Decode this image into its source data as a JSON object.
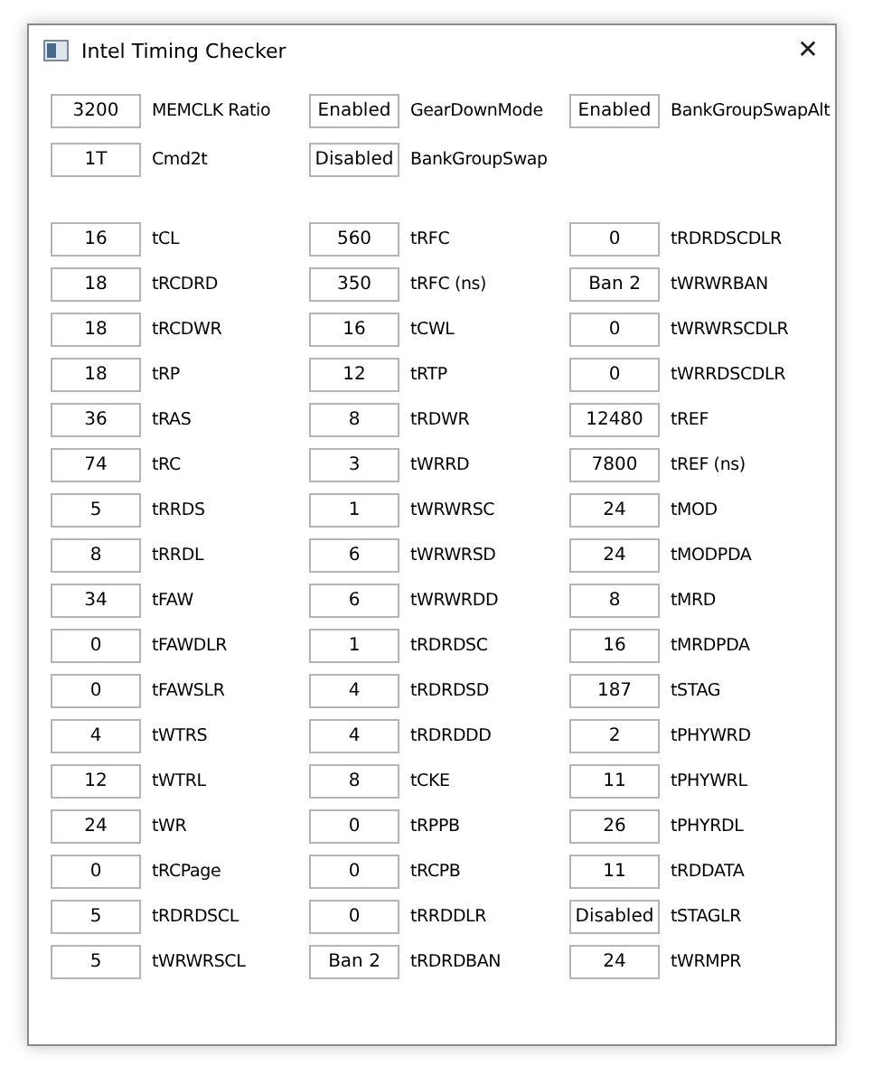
{
  "window": {
    "title": "Intel Timing Checker",
    "close": "✕"
  },
  "general": [
    {
      "value": "3200",
      "label": "MEMCLK Ratio"
    },
    {
      "value": "Enabled",
      "label": "GearDownMode"
    },
    {
      "value": "Enabled",
      "label": "BankGroupSwapAlt"
    },
    {
      "value": "1T",
      "label": "Cmd2t"
    },
    {
      "value": "Disabled",
      "label": "BankGroupSwap"
    }
  ],
  "timings": [
    {
      "value": "16",
      "label": "tCL"
    },
    {
      "value": "560",
      "label": "tRFC"
    },
    {
      "value": "0",
      "label": "tRDRDSCDLR"
    },
    {
      "value": "18",
      "label": "tRCDRD"
    },
    {
      "value": "350",
      "label": "tRFC (ns)"
    },
    {
      "value": "Ban 2",
      "label": "tWRWRBAN"
    },
    {
      "value": "18",
      "label": "tRCDWR"
    },
    {
      "value": "16",
      "label": "tCWL"
    },
    {
      "value": "0",
      "label": "tWRWRSCDLR"
    },
    {
      "value": "18",
      "label": "tRP"
    },
    {
      "value": "12",
      "label": "tRTP"
    },
    {
      "value": "0",
      "label": "tWRRDSCDLR"
    },
    {
      "value": "36",
      "label": "tRAS"
    },
    {
      "value": "8",
      "label": "tRDWR"
    },
    {
      "value": "12480",
      "label": "tREF"
    },
    {
      "value": "74",
      "label": "tRC"
    },
    {
      "value": "3",
      "label": "tWRRD"
    },
    {
      "value": "7800",
      "label": "tREF (ns)"
    },
    {
      "value": "5",
      "label": "tRRDS"
    },
    {
      "value": "1",
      "label": "tWRWRSC"
    },
    {
      "value": "24",
      "label": "tMOD"
    },
    {
      "value": "8",
      "label": "tRRDL"
    },
    {
      "value": "6",
      "label": "tWRWRSD"
    },
    {
      "value": "24",
      "label": "tMODPDA"
    },
    {
      "value": "34",
      "label": "tFAW"
    },
    {
      "value": "6",
      "label": "tWRWRDD"
    },
    {
      "value": "8",
      "label": "tMRD"
    },
    {
      "value": "0",
      "label": "tFAWDLR"
    },
    {
      "value": "1",
      "label": "tRDRDSC"
    },
    {
      "value": "16",
      "label": "tMRDPDA"
    },
    {
      "value": "0",
      "label": "tFAWSLR"
    },
    {
      "value": "4",
      "label": "tRDRDSD"
    },
    {
      "value": "187",
      "label": "tSTAG"
    },
    {
      "value": "4",
      "label": "tWTRS"
    },
    {
      "value": "4",
      "label": "tRDRDDD"
    },
    {
      "value": "2",
      "label": "tPHYWRD"
    },
    {
      "value": "12",
      "label": "tWTRL"
    },
    {
      "value": "8",
      "label": "tCKE"
    },
    {
      "value": "11",
      "label": "tPHYWRL"
    },
    {
      "value": "24",
      "label": "tWR"
    },
    {
      "value": "0",
      "label": "tRPPB"
    },
    {
      "value": "26",
      "label": "tPHYRDL"
    },
    {
      "value": "0",
      "label": "tRCPage"
    },
    {
      "value": "0",
      "label": "tRCPB"
    },
    {
      "value": "11",
      "label": "tRDDATA"
    },
    {
      "value": "5",
      "label": "tRDRDSCL"
    },
    {
      "value": "0",
      "label": "tRRDDLR"
    },
    {
      "value": "Disabled",
      "label": "tSTAGLR"
    },
    {
      "value": "5",
      "label": "tWRWRSCL"
    },
    {
      "value": "Ban 2",
      "label": "tRDRDBAN"
    },
    {
      "value": "24",
      "label": "tWRMPR"
    }
  ]
}
